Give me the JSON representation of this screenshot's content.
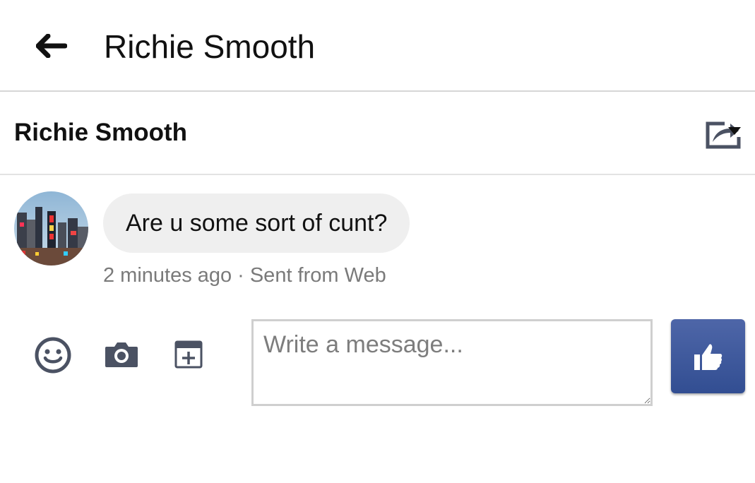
{
  "appbar": {
    "title": "Richie Smooth",
    "back_icon": "arrow-left-icon"
  },
  "thread": {
    "name": "Richie Smooth",
    "share_icon": "share-dropdown-icon"
  },
  "messages": [
    {
      "text": "Are u some sort of cunt?",
      "time": "2 minutes ago",
      "separator": "·",
      "source": "Sent from Web",
      "avatar_icon": "avatar-photo"
    }
  ],
  "composer": {
    "placeholder": "Write a message...",
    "tools": [
      "emoji-icon",
      "camera-icon",
      "sticker-icon"
    ],
    "send_icon": "thumbs-up-icon"
  },
  "colors": {
    "icon_gray": "#4b5263",
    "like_button": "#3b5998",
    "bubble": "#efefef",
    "meta_text": "#7a7a7a"
  }
}
